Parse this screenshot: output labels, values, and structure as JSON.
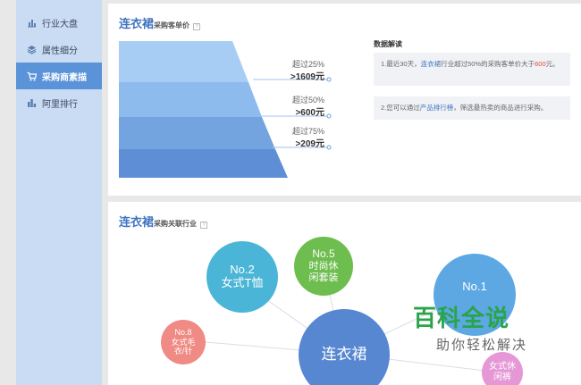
{
  "sidebar": {
    "items": [
      {
        "label": "行业大盘",
        "icon": "bar-chart-icon",
        "active": false
      },
      {
        "label": "属性细分",
        "icon": "layers-icon",
        "active": false
      },
      {
        "label": "采购商素描",
        "icon": "cart-icon",
        "active": true
      },
      {
        "label": "阿里排行",
        "icon": "ranking-icon",
        "active": false
      }
    ]
  },
  "section1": {
    "title_main": "连衣裙",
    "title_sub": "采购客单价",
    "help": "?",
    "funnel": [
      {
        "label": "超过25%",
        "value": ">1609元"
      },
      {
        "label": "超过50%",
        "value": ">600元"
      },
      {
        "label": "超过75%",
        "value": ">209元"
      }
    ],
    "insight_title": "数据解读",
    "insight1": {
      "p1": "1.最近30天，",
      "hl1": "连衣裙",
      "p2": "行业超过50%的采购客单价大于",
      "hl2": "600",
      "p3": "元。"
    },
    "insight2": {
      "p1": "2.您可以通过",
      "hl1": "产品排行榜",
      "p2": "，筛选最热卖的商品进行采购。"
    }
  },
  "section2": {
    "title_main": "连衣裙",
    "title_sub": "采购关联行业",
    "help": "?",
    "bubbles": {
      "no2": {
        "rank": "No.2",
        "name": "女式T恤"
      },
      "no5": {
        "rank": "No.5",
        "name1": "时尚休",
        "name2": "闲套装"
      },
      "no1": {
        "rank": "No.1"
      },
      "no8": {
        "rank": "No.8",
        "name1": "女式毛",
        "name2": "衣/针"
      },
      "center": {
        "name": "连衣裙"
      },
      "partial": {
        "name1": "女式休",
        "name2": "闲裤"
      }
    }
  },
  "watermark": {
    "title": "百科全说",
    "subtitle": "助你轻松解决"
  },
  "colors": {
    "accent": "#3e73c0",
    "active_nav": "#5b93d8",
    "highlight_red": "#e84a3c",
    "watermark_green": "#2aa44a"
  }
}
